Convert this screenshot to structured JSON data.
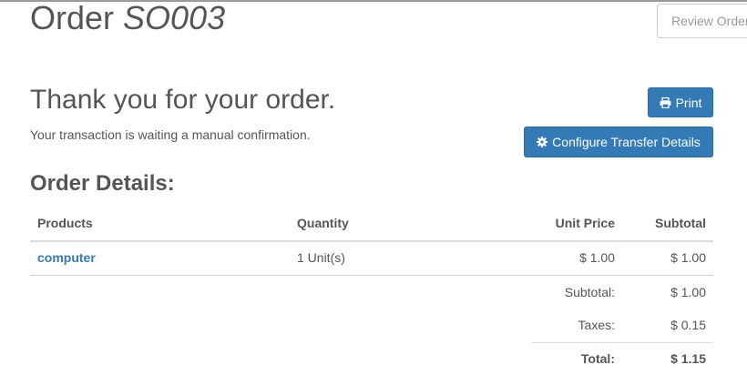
{
  "header": {
    "title_prefix": "Order",
    "order_number": "SO003",
    "review_button": "Review Order"
  },
  "confirmation": {
    "title": "Thank you for your order.",
    "status_text": "Your transaction is waiting a manual confirmation.",
    "print_label": "Print",
    "configure_label": "Configure Transfer Details",
    "print_icon": "print-icon",
    "configure_icon": "gear-icon"
  },
  "order_details": {
    "title": "Order Details:",
    "columns": {
      "products": "Products",
      "quantity": "Quantity",
      "unit_price": "Unit Price",
      "subtotal": "Subtotal"
    },
    "rows": [
      {
        "product": "computer",
        "quantity": "1 Unit(s)",
        "unit_price": "$ 1.00",
        "subtotal": "$ 1.00"
      }
    ],
    "totals": {
      "subtotal_label": "Subtotal:",
      "subtotal_value": "$ 1.00",
      "taxes_label": "Taxes:",
      "taxes_value": "$ 0.15",
      "total_label": "Total:",
      "total_value": "$ 1.15"
    }
  },
  "colors": {
    "primary": "#337ab7",
    "text": "#555555"
  }
}
